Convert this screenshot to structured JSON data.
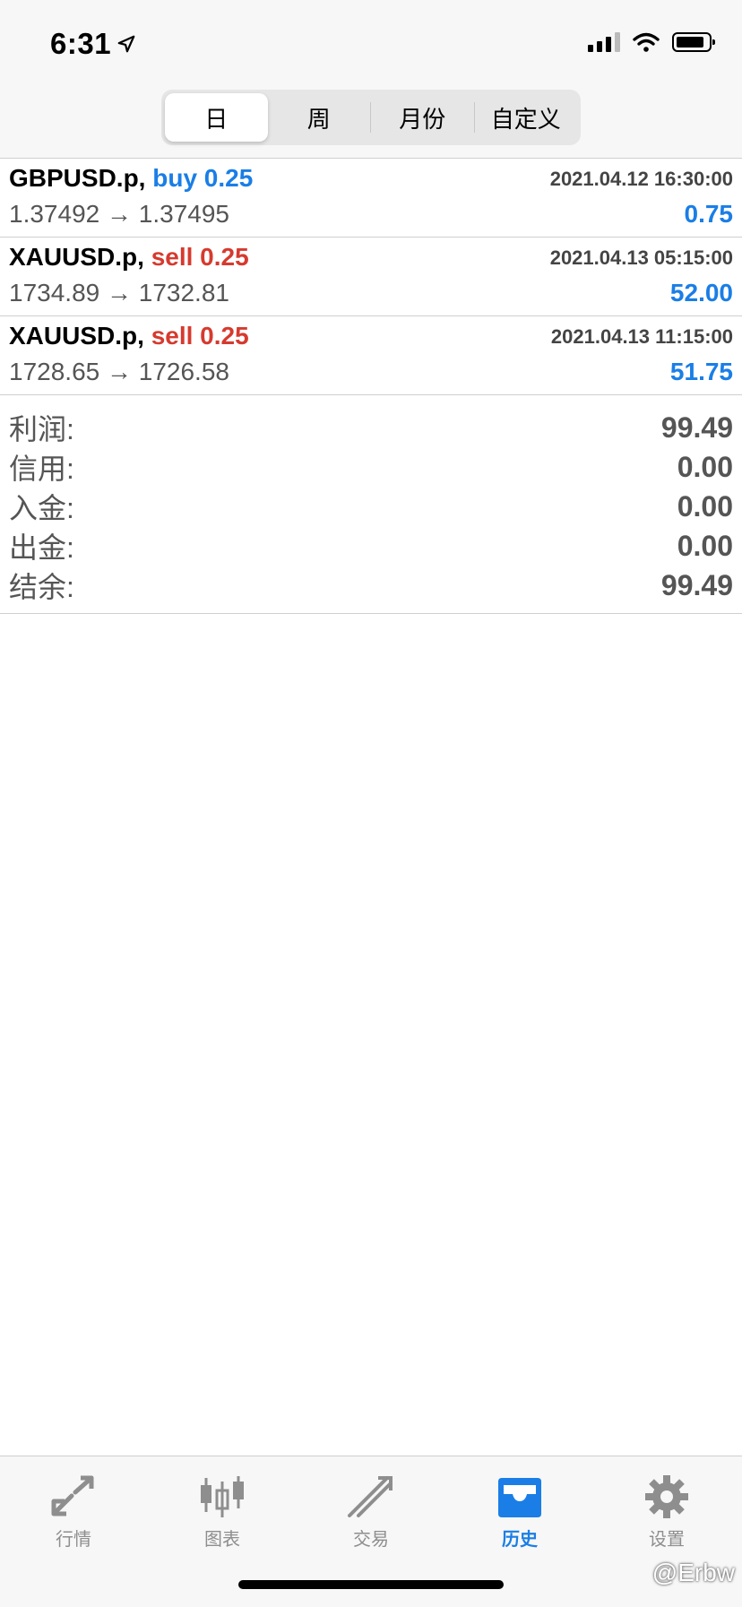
{
  "status_bar": {
    "time": "6:31"
  },
  "segments": [
    {
      "label": "日",
      "active": true
    },
    {
      "label": "周",
      "active": false
    },
    {
      "label": "月份",
      "active": false
    },
    {
      "label": "自定义",
      "active": false
    }
  ],
  "trades": [
    {
      "symbol": "GBPUSD.p,",
      "side": "buy",
      "volume_text": "buy 0.25",
      "time": "2021.04.12 16:30:00",
      "prices": "1.37492 → 1.37495",
      "profit": "0.75"
    },
    {
      "symbol": "XAUUSD.p,",
      "side": "sell",
      "volume_text": "sell 0.25",
      "time": "2021.04.13 05:15:00",
      "prices": "1734.89 → 1732.81",
      "profit": "52.00"
    },
    {
      "symbol": "XAUUSD.p,",
      "side": "sell",
      "volume_text": "sell 0.25",
      "time": "2021.04.13 11:15:00",
      "prices": "1728.65 → 1726.58",
      "profit": "51.75"
    }
  ],
  "summary": [
    {
      "label": "利润:",
      "value": "99.49"
    },
    {
      "label": "信用:",
      "value": "0.00"
    },
    {
      "label": "入金:",
      "value": "0.00"
    },
    {
      "label": "出金:",
      "value": "0.00"
    },
    {
      "label": "结余:",
      "value": "99.49"
    }
  ],
  "tabbar": [
    {
      "label": "行情",
      "icon": "quotes-icon",
      "active": false
    },
    {
      "label": "图表",
      "icon": "chart-icon",
      "active": false
    },
    {
      "label": "交易",
      "icon": "trade-icon",
      "active": false
    },
    {
      "label": "历史",
      "icon": "history-icon",
      "active": true
    },
    {
      "label": "设置",
      "icon": "settings-icon",
      "active": false
    }
  ],
  "watermark": "@Erbw",
  "colors": {
    "accent_blue": "#1a7ee6",
    "sell_red": "#d63a2e"
  }
}
